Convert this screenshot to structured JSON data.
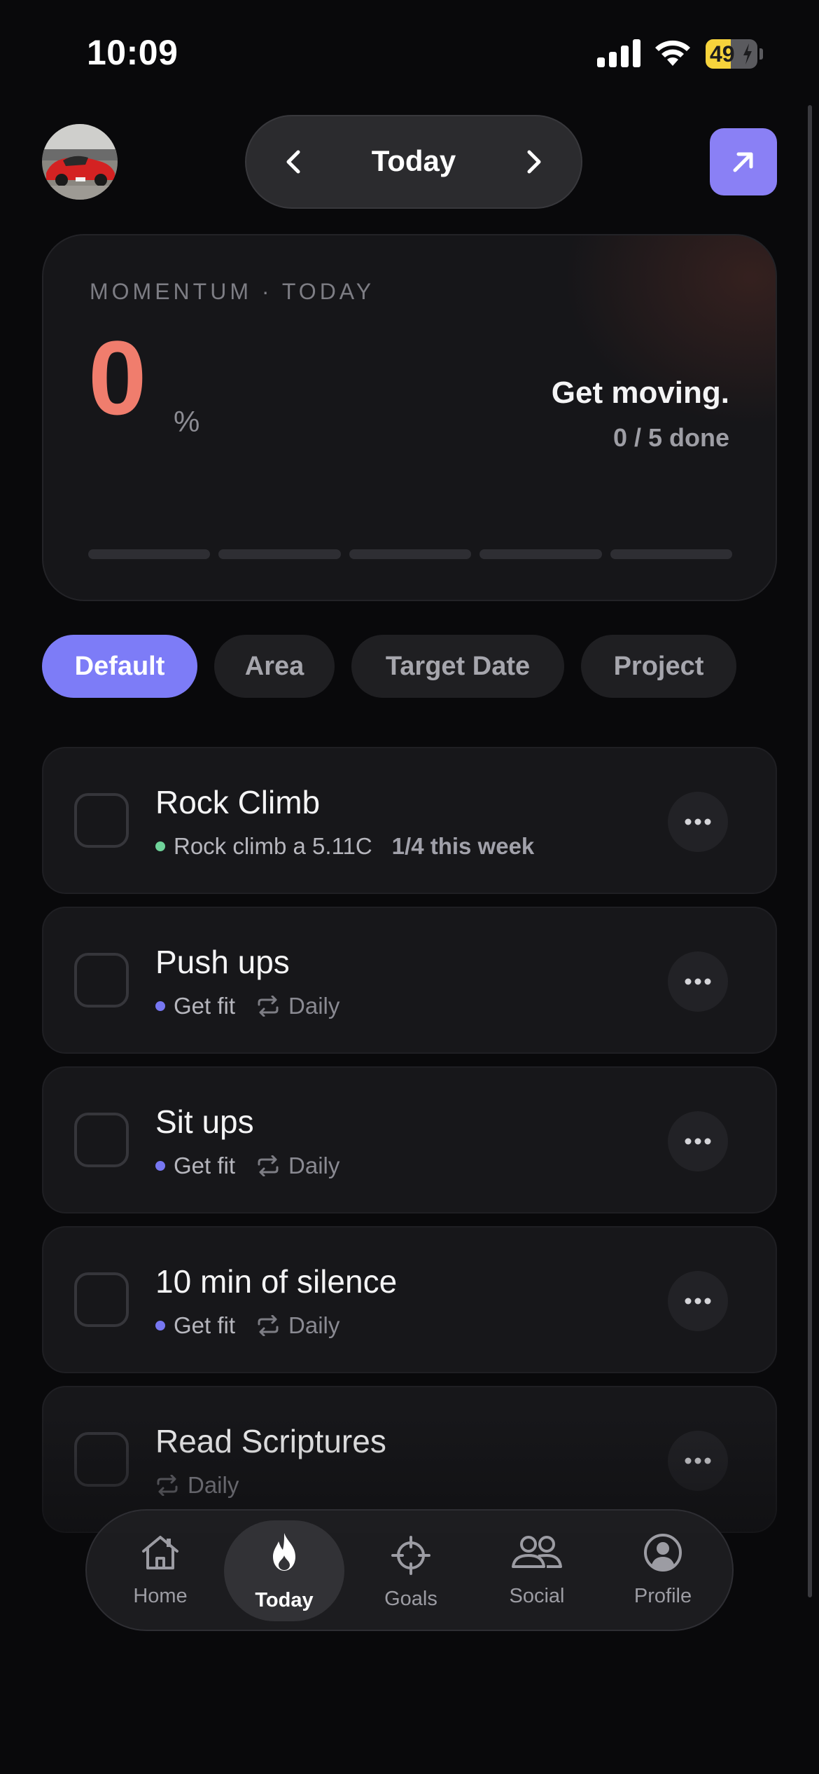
{
  "status_bar": {
    "time": "10:09",
    "battery_percent": "49",
    "battery_level": 0.49
  },
  "header": {
    "date_label": "Today"
  },
  "momentum": {
    "label": "MOMENTUM · TODAY",
    "value": "0",
    "unit": "%",
    "message": "Get moving.",
    "count": "0 / 5 done",
    "segments": 5,
    "completed": 0
  },
  "filters": [
    {
      "label": "Default",
      "active": true
    },
    {
      "label": "Area",
      "active": false
    },
    {
      "label": "Target Date",
      "active": false
    },
    {
      "label": "Project",
      "active": false
    }
  ],
  "tasks": [
    {
      "title": "Rock Climb",
      "goal": "Rock climb a 5.11C",
      "goal_color": "#6fd39a",
      "progress": "1/4 this week",
      "frequency": ""
    },
    {
      "title": "Push ups",
      "goal": "Get fit",
      "goal_color": "#7777f2",
      "progress": "",
      "frequency": "Daily"
    },
    {
      "title": "Sit ups",
      "goal": "Get fit",
      "goal_color": "#7777f2",
      "progress": "",
      "frequency": "Daily"
    },
    {
      "title": "10 min of silence",
      "goal": "Get fit",
      "goal_color": "#7777f2",
      "progress": "",
      "frequency": "Daily"
    },
    {
      "title": "Read Scriptures",
      "goal": "",
      "goal_color": "",
      "progress": "",
      "frequency": "Daily"
    }
  ],
  "tab_bar": {
    "tabs": [
      {
        "label": "Home",
        "icon": "home-icon",
        "active": false
      },
      {
        "label": "Today",
        "icon": "flame-icon",
        "active": true
      },
      {
        "label": "Goals",
        "icon": "target-icon",
        "active": false
      },
      {
        "label": "Social",
        "icon": "people-icon",
        "active": false
      },
      {
        "label": "Profile",
        "icon": "profile-icon",
        "active": false
      }
    ]
  },
  "colors": {
    "accent": "#7d7cf7",
    "momentum_value": "#f07d6d",
    "background": "#09090b"
  }
}
